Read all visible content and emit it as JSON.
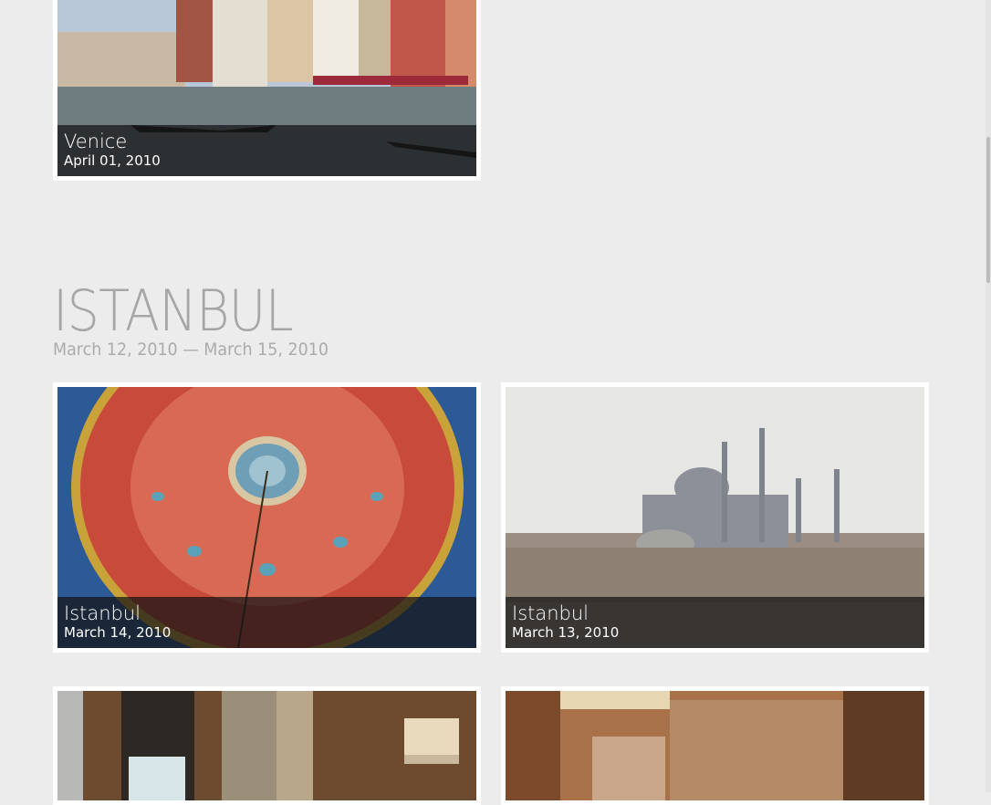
{
  "venice": {
    "title": "Venice",
    "date": "April 01, 2010"
  },
  "section": {
    "title": "ISTANBUL",
    "dates": "March 12, 2010 — March 15, 2010"
  },
  "photos": [
    {
      "title": "Istanbul",
      "date": "March 14, 2010"
    },
    {
      "title": "Istanbul",
      "date": "March 13, 2010"
    }
  ],
  "colors": {
    "background": "#ececec",
    "caption_bg": "#141414",
    "heading": "#a6a6a6"
  }
}
